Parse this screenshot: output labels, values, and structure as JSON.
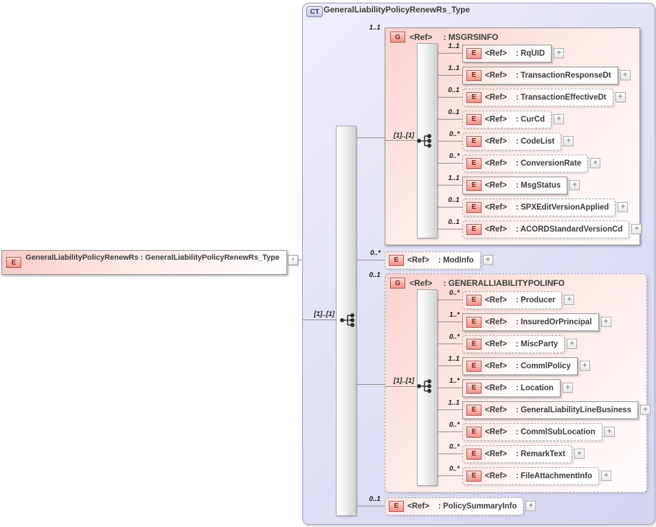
{
  "root_element": {
    "badge": "E",
    "label": "GeneralLiabilityPolicyRenewRs : GeneralLiabilityPolicyRenewRs_Type"
  },
  "complex_type": {
    "badge": "CT",
    "title": "GeneralLiabilityPolicyRenewRs_Type",
    "compositor": {
      "type": "sequence",
      "cardinality": "[1]..[1]"
    },
    "children": [
      {
        "kind": "group",
        "badge": "G",
        "ref": "<Ref>",
        "label": ": MSGRSINFO",
        "cardinality": "1..1",
        "optional": false,
        "compositor": {
          "type": "sequence",
          "cardinality": "[1]..[1]"
        },
        "children": [
          {
            "badge": "E",
            "ref": "<Ref>",
            "label": ": RqUID",
            "cardinality": "1..1",
            "optional": false
          },
          {
            "badge": "E",
            "ref": "<Ref>",
            "label": ": TransactionResponseDt",
            "cardinality": "1..1",
            "optional": false
          },
          {
            "badge": "E",
            "ref": "<Ref>",
            "label": ": TransactionEffectiveDt",
            "cardinality": "0..1",
            "optional": true
          },
          {
            "badge": "E",
            "ref": "<Ref>",
            "label": ": CurCd",
            "cardinality": "0..1",
            "optional": true
          },
          {
            "badge": "E",
            "ref": "<Ref>",
            "label": ": CodeList",
            "cardinality": "0..*",
            "optional": true
          },
          {
            "badge": "E",
            "ref": "<Ref>",
            "label": ": ConversionRate",
            "cardinality": "0..*",
            "optional": true
          },
          {
            "badge": "E",
            "ref": "<Ref>",
            "label": ": MsgStatus",
            "cardinality": "1..1",
            "optional": false
          },
          {
            "badge": "E",
            "ref": "<Ref>",
            "label": ": SPXEditVersionApplied",
            "cardinality": "0..1",
            "optional": true
          },
          {
            "badge": "E",
            "ref": "<Ref>",
            "label": ": ACORDStandardVersionCd",
            "cardinality": "0..1",
            "optional": true
          }
        ]
      },
      {
        "kind": "element",
        "badge": "E",
        "ref": "<Ref>",
        "label": ": ModInfo",
        "cardinality": "0..*",
        "optional": true
      },
      {
        "kind": "group",
        "badge": "G",
        "ref": "<Ref>",
        "label": ": GENERALLIABILITYPOLINFO",
        "cardinality": "0..1",
        "optional": true,
        "compositor": {
          "type": "sequence",
          "cardinality": "[1]..[1]"
        },
        "children": [
          {
            "badge": "E",
            "ref": "<Ref>",
            "label": ": Producer",
            "cardinality": "0..*",
            "optional": true
          },
          {
            "badge": "E",
            "ref": "<Ref>",
            "label": ": InsuredOrPrincipal",
            "cardinality": "1..*",
            "optional": false
          },
          {
            "badge": "E",
            "ref": "<Ref>",
            "label": ": MiscParty",
            "cardinality": "0..*",
            "optional": true
          },
          {
            "badge": "E",
            "ref": "<Ref>",
            "label": ": CommlPolicy",
            "cardinality": "1..1",
            "optional": false
          },
          {
            "badge": "E",
            "ref": "<Ref>",
            "label": ": Location",
            "cardinality": "1..*",
            "optional": false
          },
          {
            "badge": "E",
            "ref": "<Ref>",
            "label": ": GeneralLiabilityLineBusiness",
            "cardinality": "1..1",
            "optional": false
          },
          {
            "badge": "E",
            "ref": "<Ref>",
            "label": ": CommlSubLocation",
            "cardinality": "0..*",
            "optional": true
          },
          {
            "badge": "E",
            "ref": "<Ref>",
            "label": ": RemarkText",
            "cardinality": "0..*",
            "optional": true
          },
          {
            "badge": "E",
            "ref": "<Ref>",
            "label": ": FileAttachmentInfo",
            "cardinality": "0..*",
            "optional": true
          }
        ]
      },
      {
        "kind": "element",
        "badge": "E",
        "ref": "<Ref>",
        "label": ": PolicySummaryInfo",
        "cardinality": "0..1",
        "optional": true
      }
    ]
  },
  "icons": {
    "expand": "+",
    "collapse": "-"
  },
  "colors": {
    "container_lavender": "#dcdcf4",
    "group_pink": "#fad2ce",
    "badge_red_border": "#ae524c",
    "badge_text": "#76221d",
    "box_border": "#8f8f8f",
    "line_gray": "#8c8c8c"
  }
}
